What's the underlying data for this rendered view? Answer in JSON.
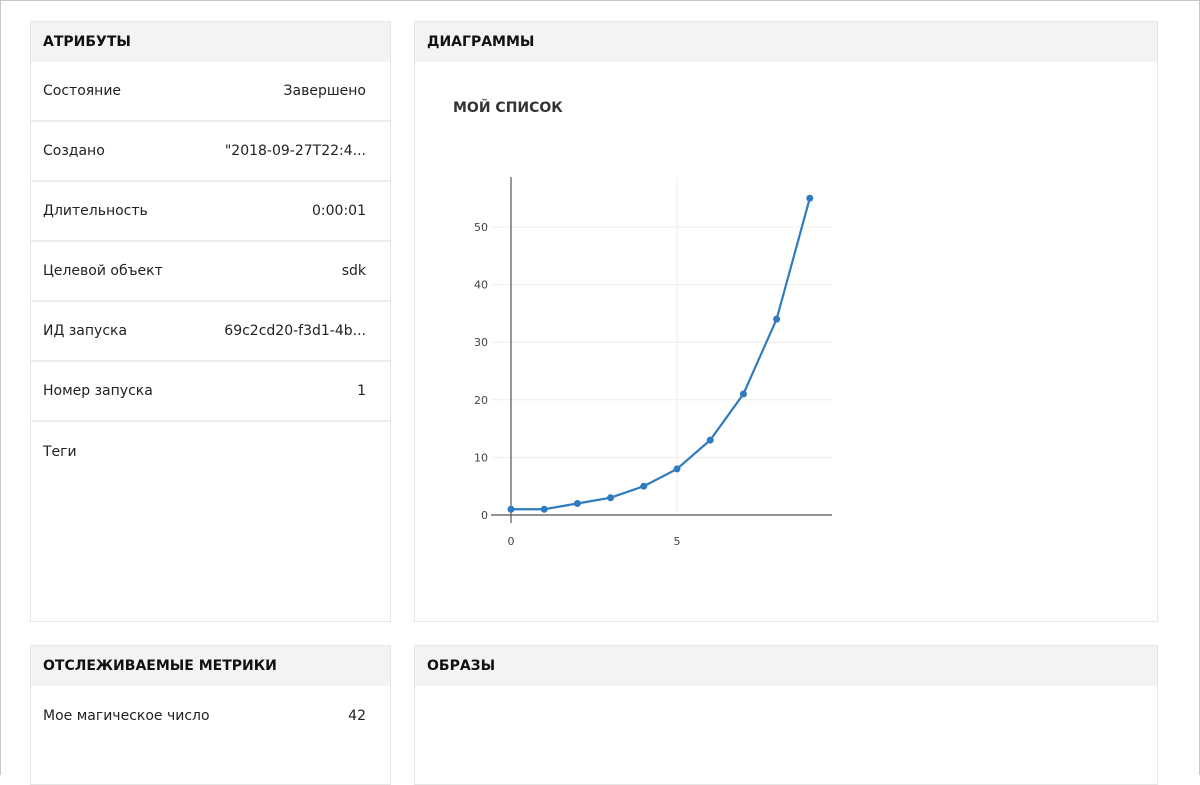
{
  "attributes": {
    "title": "АТРИБУТЫ",
    "rows": [
      {
        "label": "Состояние",
        "value": "Завершено"
      },
      {
        "label": "Создано",
        "value": "\"2018-09-27T22:4..."
      },
      {
        "label": "Длительность",
        "value": "0:00:01"
      },
      {
        "label": "Целевой объект",
        "value": "sdk"
      },
      {
        "label": "ИД запуска",
        "value": "69c2cd20-f3d1-4b..."
      },
      {
        "label": "Номер запуска",
        "value": "1"
      },
      {
        "label": "Теги",
        "value": ""
      }
    ]
  },
  "charts": {
    "title": "ДИАГРАММЫ"
  },
  "metrics": {
    "title": "ОТСЛЕЖИВАЕМЫЕ МЕТРИКИ",
    "rows": [
      {
        "label": "Мое магическое число",
        "value": "42"
      }
    ]
  },
  "images": {
    "title": "ОБРАЗЫ"
  },
  "chart_data": {
    "type": "line",
    "title": "мой список",
    "x": [
      0,
      1,
      2,
      3,
      4,
      5,
      6,
      7,
      8,
      9
    ],
    "y": [
      1,
      1,
      2,
      3,
      5,
      8,
      13,
      21,
      34,
      55
    ],
    "xticks": [
      "0",
      "5"
    ],
    "yticks": [
      "0",
      "10",
      "20",
      "30",
      "40",
      "50"
    ],
    "xlim": [
      -0.6,
      9.7
    ],
    "ylim": [
      -2,
      59
    ],
    "color": "#2e7bbf",
    "grid": true
  }
}
